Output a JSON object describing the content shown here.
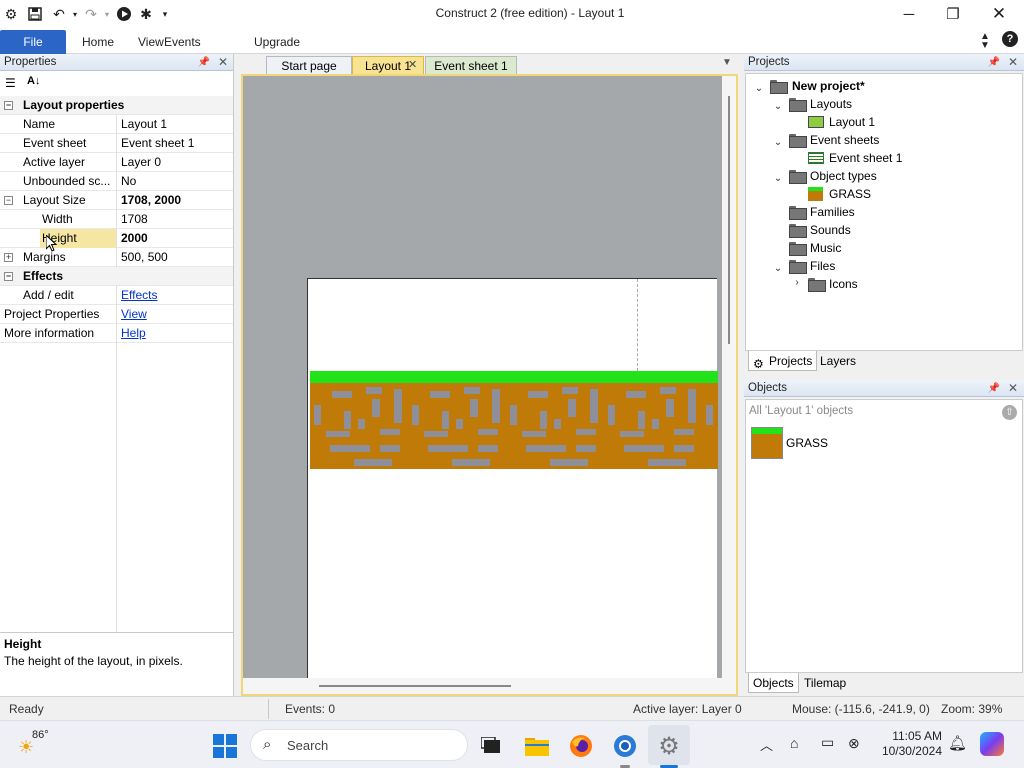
{
  "window": {
    "title": "Construct 2  (free edition) - Layout 1",
    "controls": [
      "minimize-icon",
      "restore-icon",
      "close-icon"
    ]
  },
  "ribbon": {
    "tabs": [
      {
        "label": "File"
      },
      {
        "label": "Home"
      },
      {
        "label": "View"
      },
      {
        "label": "Events"
      },
      {
        "label": "Upgrade"
      }
    ]
  },
  "properties": {
    "title": "Properties",
    "rows": [
      {
        "name": "Layout properties",
        "kind": "category"
      },
      {
        "name": "Name",
        "value": "Layout 1"
      },
      {
        "name": "Event sheet",
        "value": "Event sheet 1"
      },
      {
        "name": "Active layer",
        "value": "Layer 0"
      },
      {
        "name": "Unbounded sc...",
        "value": "No"
      },
      {
        "name": "Layout Size",
        "value": "1708, 2000"
      },
      {
        "name": "Width",
        "value": "1708"
      },
      {
        "name": "Height",
        "value": "2000"
      },
      {
        "name": "Margins",
        "value": "500, 500"
      },
      {
        "name": "Effects",
        "kind": "category"
      },
      {
        "name": "Add / edit",
        "value": "Effects"
      },
      {
        "name": "Project Properties",
        "value": "View"
      },
      {
        "name": "More information",
        "value": "Help"
      }
    ],
    "desc_title": "Height",
    "desc_text": "The height of the layout, in pixels."
  },
  "doc_tabs": [
    {
      "label": "Start page"
    },
    {
      "label": "Layout 1",
      "active": true
    },
    {
      "label": "Event sheet 1"
    }
  ],
  "projects": {
    "title": "Projects",
    "tree": {
      "root": "New project*",
      "layouts": "Layouts",
      "layout1": "Layout 1",
      "event_sheets": "Event sheets",
      "event_sheet1": "Event sheet 1",
      "object_types": "Object types",
      "grass": "GRASS",
      "families": "Families",
      "sounds": "Sounds",
      "music": "Music",
      "files": "Files",
      "icons": "Icons"
    },
    "tabs": [
      "Projects",
      "Layers"
    ]
  },
  "objects": {
    "title": "Objects",
    "filter": "All 'Layout 1' objects",
    "items": [
      "GRASS"
    ],
    "tabs": [
      "Objects",
      "Tilemap"
    ]
  },
  "status": {
    "ready": "Ready",
    "events": "Events: 0",
    "active_layer": "Active layer: Layer 0",
    "mouse": "Mouse: (-115.6, -241.9, 0)",
    "zoom": "Zoom: 39%"
  },
  "taskbar": {
    "weather_temp": "86°",
    "search_placeholder": "Search",
    "time": "11:05 AM",
    "date": "10/30/2024"
  },
  "colors": {
    "accent": "#2b65c6",
    "grass_top": "#22e21a",
    "dirt": "#c07a08",
    "stone": "#8e8f99"
  }
}
